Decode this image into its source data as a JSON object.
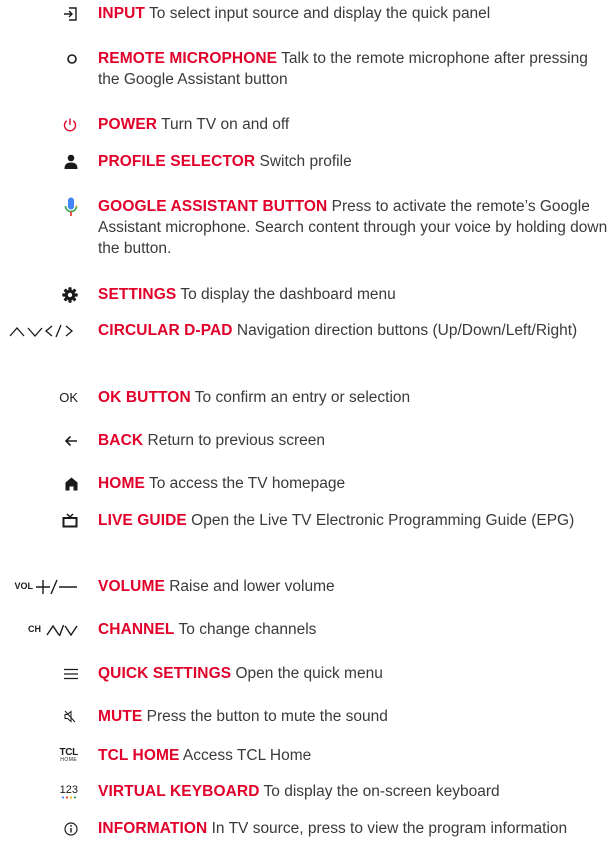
{
  "colors": {
    "accent": "#e0002a",
    "text": "#3a3a3a",
    "icon": "#1a1a1a"
  },
  "items": [
    {
      "icon": "input-icon",
      "name": "INPUT",
      "desc": "To select input source and display the quick panel"
    },
    {
      "icon": "mic-dot-icon",
      "name": "REMOTE MICROPHONE",
      "desc": "Talk to the remote microphone after pressing the Google Assistant button"
    },
    {
      "icon": "power-icon",
      "name": "POWER",
      "desc": "Turn TV on and off"
    },
    {
      "icon": "person-icon",
      "name": "PROFILE SELECTOR",
      "desc": "Switch profile"
    },
    {
      "icon": "google-mic-icon",
      "name": "GOOGLE ASSISTANT BUTTON",
      "desc": "Press to activate the remote’s Google Assistant microphone. Search content through your voice by holding down the button."
    },
    {
      "icon": "gear-icon",
      "name": "SETTINGS",
      "desc": "To display the dashboard menu"
    },
    {
      "icon": "dpad-arrows-icon",
      "name": "CIRCULAR D-PAD",
      "desc": "Navigation direction buttons (Up/Down/Left/Right)"
    },
    {
      "icon": "ok-icon",
      "icon_text": "OK",
      "name": "OK BUTTON",
      "desc": "To confirm an entry or selection"
    },
    {
      "icon": "back-arrow-icon",
      "name": "BACK",
      "desc": "Return to previous screen"
    },
    {
      "icon": "home-icon",
      "name": "HOME",
      "desc": "To access the TV homepage"
    },
    {
      "icon": "tv-guide-icon",
      "name": "LIVE GUIDE",
      "desc": "Open the Live TV Electronic Programming Guide (EPG)"
    },
    {
      "icon": "volume-icon",
      "icon_text": "VOL",
      "name": "VOLUME",
      "desc": "Raise and lower volume"
    },
    {
      "icon": "channel-icon",
      "icon_text": "CH",
      "name": "CHANNEL",
      "desc": "To change channels"
    },
    {
      "icon": "menu-lines-icon",
      "name": "QUICK SETTINGS",
      "desc": "Open the quick menu"
    },
    {
      "icon": "mute-icon",
      "name": "MUTE",
      "desc": "Press the button to mute the sound"
    },
    {
      "icon": "tcl-home-icon",
      "icon_text": "TCL",
      "icon_subtext": "HOME",
      "name": "TCL HOME",
      "desc": "Access TCL Home"
    },
    {
      "icon": "keyboard-123-icon",
      "icon_text": "123",
      "name": "VIRTUAL KEYBOARD",
      "desc": "To display the on-screen keyboard"
    },
    {
      "icon": "info-icon",
      "name": "INFORMATION",
      "desc": "In TV source, press to view the program information"
    }
  ]
}
